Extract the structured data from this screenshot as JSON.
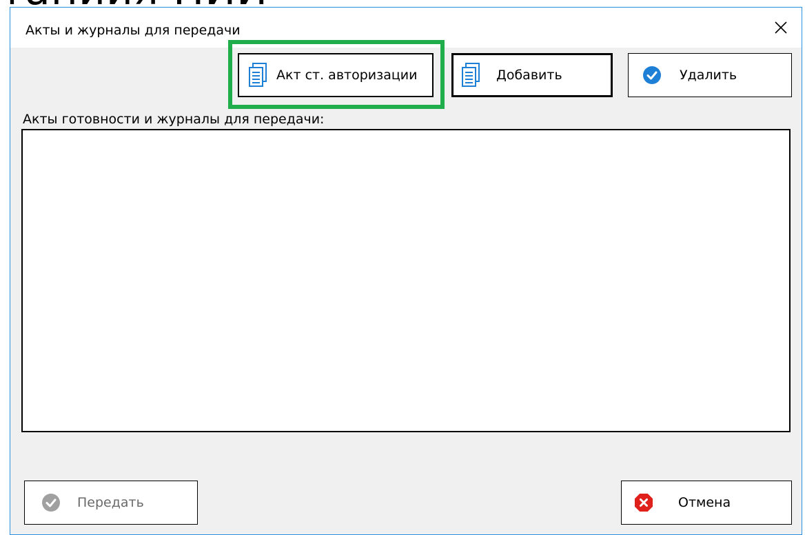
{
  "background_partial_text": "таниия НИИ",
  "window": {
    "title": "Акты и журналы для передачи"
  },
  "toolbar": {
    "act_button": "Акт ст. авторизации",
    "add_button": "Добавить",
    "delete_button": "Удалить"
  },
  "main": {
    "list_label": "Акты готовности и журналы для передачи:",
    "items": []
  },
  "footer": {
    "send_button": "Передать",
    "cancel_button": "Отмена"
  },
  "colors": {
    "highlight": "#1fae4b",
    "window_border": "#2b8fe0",
    "check_blue": "#1e7fd6",
    "cancel_red": "#e0201b",
    "disabled_gray": "#a0a0a0"
  }
}
